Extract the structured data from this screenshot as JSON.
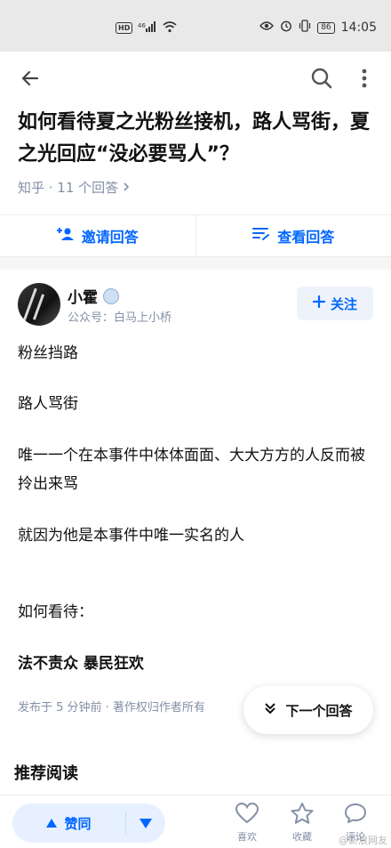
{
  "statusbar": {
    "hd": "HD",
    "signal": "⁴⁶",
    "battery": "86",
    "time": "14:05"
  },
  "question": {
    "title": "如何看待夏之光粉丝接机，路人骂街，夏之光回应“没必要骂人”？",
    "meta": "知乎 · 11 个回答"
  },
  "actions": {
    "invite": "邀请回答",
    "view": "查看回答"
  },
  "answer": {
    "author_name": "小霍",
    "author_subtitle": "公众号：白马上小桥",
    "follow_label": "关注",
    "paragraphs": [
      "粉丝挡路",
      "路人骂街",
      "唯一一个在本事件中体体面面、大大方方的人反而被拎出来骂",
      "就因为他是本事件中唯一实名的人",
      "如何看待：",
      "法不责众 暴民狂欢"
    ],
    "footer": "发布于 5 分钟前 · 著作权归作者所有"
  },
  "next_answer": "下一个回答",
  "recommend_title": "推荐阅读",
  "bottombar": {
    "vote_label": "赞同",
    "like": "喜欢",
    "favorite": "收藏",
    "comment": "评论"
  },
  "watermark": "@新浪网友",
  "colors": {
    "accent": "#0066ff",
    "muted": "#8590a6"
  }
}
